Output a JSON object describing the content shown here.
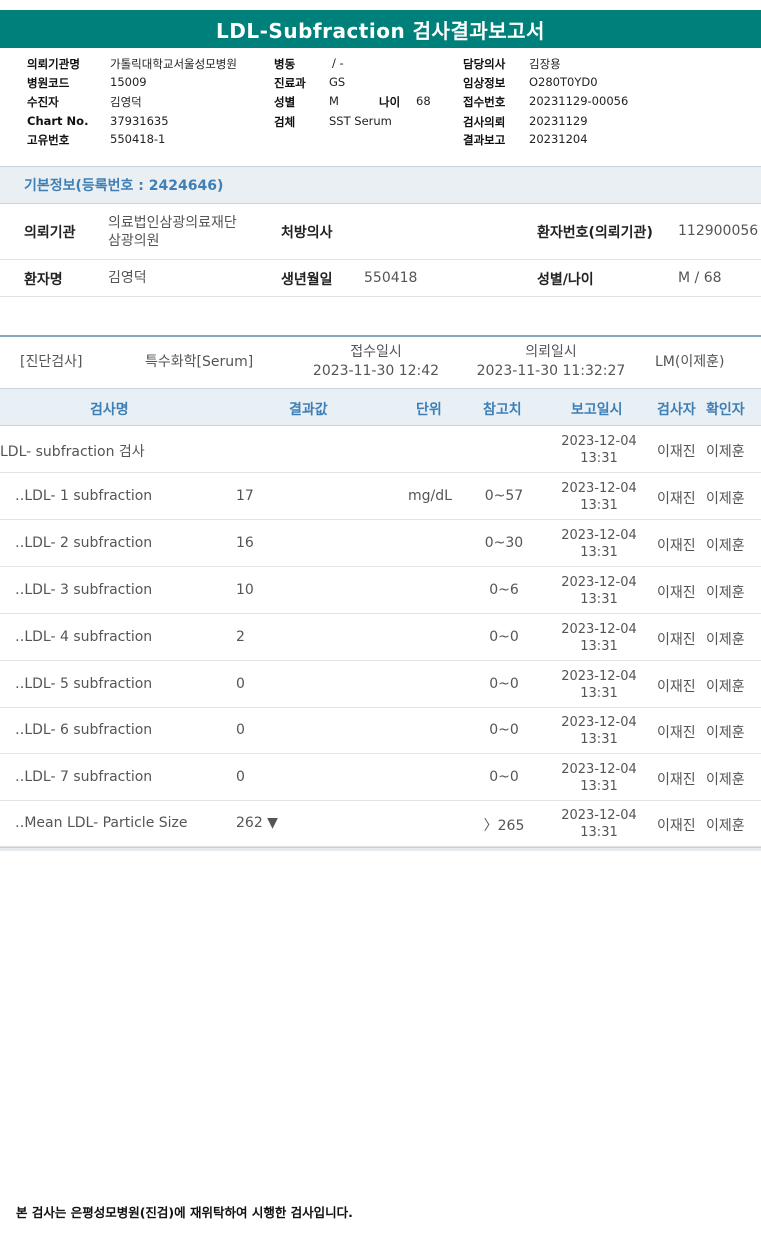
{
  "report": {
    "title": "LDL-Subfraction 검사결과보고서"
  },
  "header": {
    "col1": [
      {
        "label": "의뢰기관명",
        "value": "가톨릭대학교서울성모병원"
      },
      {
        "label": "병원코드",
        "value": "15009"
      },
      {
        "label": "수진자",
        "value": "김영덕"
      },
      {
        "label": "Chart No.",
        "value": "37931635"
      },
      {
        "label": "고유번호",
        "value": "550418-1"
      }
    ],
    "col2": [
      {
        "label": "병동",
        "value": "/ -"
      },
      {
        "label": "진료과",
        "value": "GS"
      },
      {
        "label": "성별",
        "value": "M"
      },
      {
        "label": "검체",
        "value": "SST Serum"
      }
    ],
    "age": {
      "label": "나이",
      "value": "68"
    },
    "col3": [
      {
        "label": "담당의사",
        "value": "김장용"
      },
      {
        "label": "임상정보",
        "value": "O280T0YD0"
      },
      {
        "label": "접수번호",
        "value": "20231129-00056"
      },
      {
        "label": "검사의뢰",
        "value": "20231129"
      },
      {
        "label": "결과보고",
        "value": "20231204"
      }
    ]
  },
  "basic_info": {
    "section_title": "기본정보(등록번호 : 2424646)",
    "row1": {
      "institution_label": "의뢰기관",
      "institution_line1": "의료법인삼광의료재단",
      "institution_line2": "삼광의원",
      "doctor_label": "처방의사",
      "doctor_value": "",
      "patient_no_label": "환자번호(의뢰기관)",
      "patient_no_value": "112900056"
    },
    "row2": {
      "name_label": "환자명",
      "name_value": "김영덕",
      "birth_label": "생년월일",
      "birth_value": "550418",
      "sexage_label": "성별/나이",
      "sexage_value": "M / 68"
    }
  },
  "test_header": {
    "category": "[진단검사]",
    "sub_category": "특수화학[Serum]",
    "receipt_label": "접수일시",
    "receipt_value": "2023-11-30 12:42",
    "request_label": "의뢰일시",
    "request_value": "2023-11-30 11:32:27",
    "lm": "LM(이제훈)"
  },
  "table": {
    "columns": [
      "검사명",
      "결과값",
      "단위",
      "참고치",
      "보고일시",
      "검사자",
      "확인자"
    ],
    "rows": [
      {
        "name": "LDL- subfraction 검사",
        "result": "",
        "unit": "",
        "ref": "",
        "date": "2023-12-04",
        "time": "13:31",
        "tester": "이재진",
        "confirmer": "이제훈"
      },
      {
        "name": "‥LDL- 1 subfraction",
        "result": "17",
        "unit": "mg/dL",
        "ref": "0~57",
        "date": "2023-12-04",
        "time": "13:31",
        "tester": "이재진",
        "confirmer": "이제훈"
      },
      {
        "name": "‥LDL- 2 subfraction",
        "result": "16",
        "unit": "",
        "ref": "0~30",
        "date": "2023-12-04",
        "time": "13:31",
        "tester": "이재진",
        "confirmer": "이제훈"
      },
      {
        "name": "‥LDL- 3 subfraction",
        "result": "10",
        "unit": "",
        "ref": "0~6",
        "date": "2023-12-04",
        "time": "13:31",
        "tester": "이재진",
        "confirmer": "이제훈"
      },
      {
        "name": "‥LDL- 4 subfraction",
        "result": "2",
        "unit": "",
        "ref": "0~0",
        "date": "2023-12-04",
        "time": "13:31",
        "tester": "이재진",
        "confirmer": "이제훈"
      },
      {
        "name": "‥LDL- 5 subfraction",
        "result": "0",
        "unit": "",
        "ref": "0~0",
        "date": "2023-12-04",
        "time": "13:31",
        "tester": "이재진",
        "confirmer": "이제훈"
      },
      {
        "name": "‥LDL- 6 subfraction",
        "result": "0",
        "unit": "",
        "ref": "0~0",
        "date": "2023-12-04",
        "time": "13:31",
        "tester": "이재진",
        "confirmer": "이제훈"
      },
      {
        "name": "‥LDL- 7 subfraction",
        "result": "0",
        "unit": "",
        "ref": "0~0",
        "date": "2023-12-04",
        "time": "13:31",
        "tester": "이재진",
        "confirmer": "이제훈"
      },
      {
        "name": "‥Mean LDL- Particle Size",
        "result": "262 ▼",
        "unit": "",
        "ref": "〉265",
        "date": "2023-12-04",
        "time": "13:31",
        "tester": "이재진",
        "confirmer": "이제훈"
      }
    ]
  },
  "footer": {
    "note": "본 검사는 은평성모병원(진검)에 재위탁하여 시행한 검사입니다."
  }
}
